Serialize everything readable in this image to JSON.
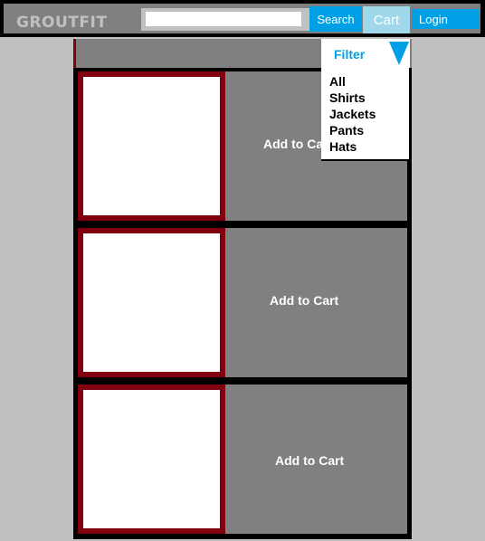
{
  "header": {
    "logo": "GROUTFIT",
    "search_placeholder": "",
    "search_label": "Search",
    "cart_label": "Cart",
    "login_label": "Login"
  },
  "filter": {
    "label": "Filter",
    "options": [
      "All",
      "Shirts",
      "Jackets",
      "Pants",
      "Hats"
    ]
  },
  "products": [
    {
      "add_label": "Add to Cart"
    },
    {
      "add_label": "Add to Cart"
    },
    {
      "add_label": "Add to Cart"
    }
  ],
  "colors": {
    "accent": "#00a0e6",
    "cart": "#9fd8ea",
    "frame": "#800010",
    "panel": "#808080",
    "background": "#c0c0c0"
  }
}
